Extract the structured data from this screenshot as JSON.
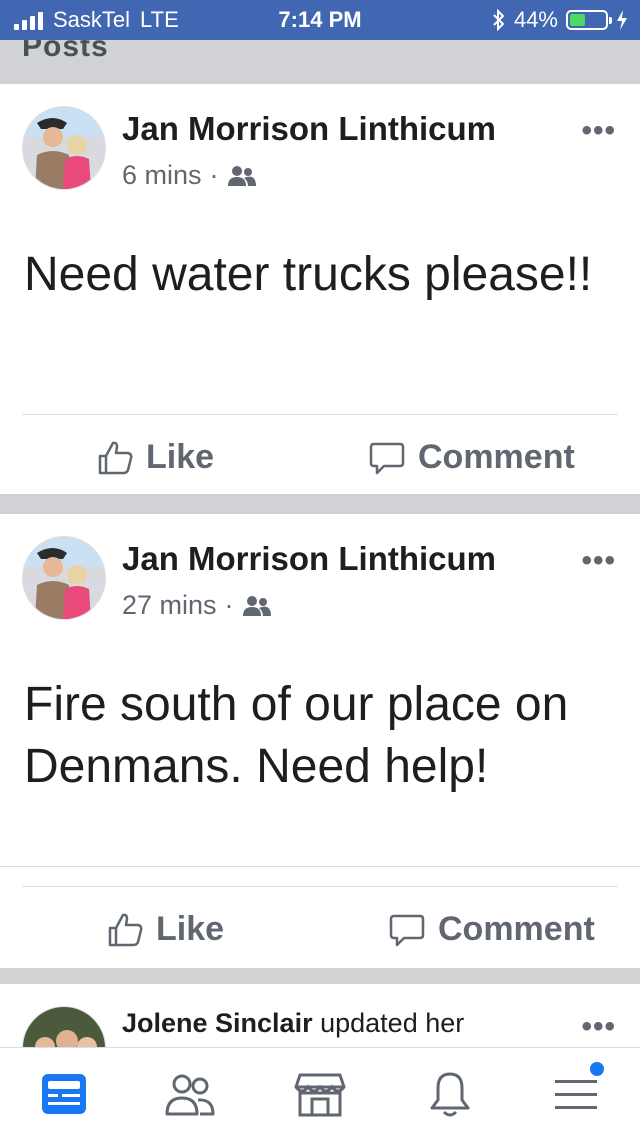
{
  "status_bar": {
    "carrier": "SaskTel",
    "network": "LTE",
    "time": "7:14 PM",
    "battery": "44%",
    "battery_level": 0.44
  },
  "section": {
    "title": "Posts"
  },
  "posts": [
    {
      "author": "Jan Morrison Linthicum",
      "time": "6 mins",
      "separator": "·",
      "audience_icon": "group-icon",
      "text": "Need water trucks please!!",
      "like_label": "Like",
      "comment_label": "Comment"
    },
    {
      "author": "Jan Morrison Linthicum",
      "time": "27 mins",
      "separator": "·",
      "audience_icon": "group-icon",
      "text": "Fire south of our place on Denmans. Need help!",
      "like_label": "Like",
      "comment_label": "Comment"
    },
    {
      "author": "Jolene Sinclair",
      "action": "updated her"
    }
  ],
  "more_label": "•••",
  "tab_bar": {
    "items": [
      "news-feed-icon",
      "friends-icon",
      "marketplace-icon",
      "notifications-icon",
      "menu-icon"
    ],
    "active": "news-feed-icon",
    "accent_color": "#1877f2"
  },
  "colors": {
    "header_blue": "#4267b2",
    "separator_gray": "#d0d2d6"
  }
}
